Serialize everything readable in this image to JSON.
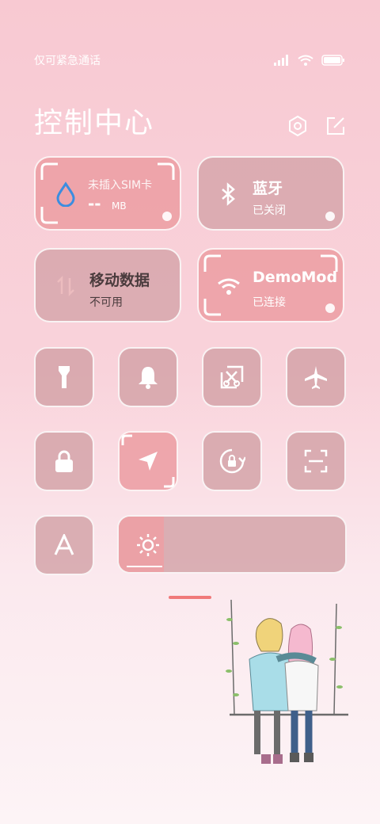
{
  "status": {
    "carrier_text": "仅可紧急通话"
  },
  "header": {
    "title": "控制中心"
  },
  "tiles": {
    "data_usage": {
      "title": "未插入SIM卡",
      "value": "--",
      "unit": "MB"
    },
    "bluetooth": {
      "title": "蓝牙",
      "status": "已关闭"
    },
    "mobile_data": {
      "title": "移动数据",
      "status": "不可用"
    },
    "wifi": {
      "title": "DemoMod",
      "status": "已连接"
    }
  },
  "small_toggles": [
    "flashlight-icon",
    "bell-icon",
    "screenshot-icon",
    "airplane-icon",
    "lock-icon",
    "location-icon",
    "rotation-lock-icon",
    "scan-icon",
    "font-icon"
  ],
  "brightness": {
    "level": 0.2
  },
  "colors": {
    "accent": "#f07a7a",
    "tile": "#d2a0a5",
    "tile_active": "#eca0a5"
  }
}
